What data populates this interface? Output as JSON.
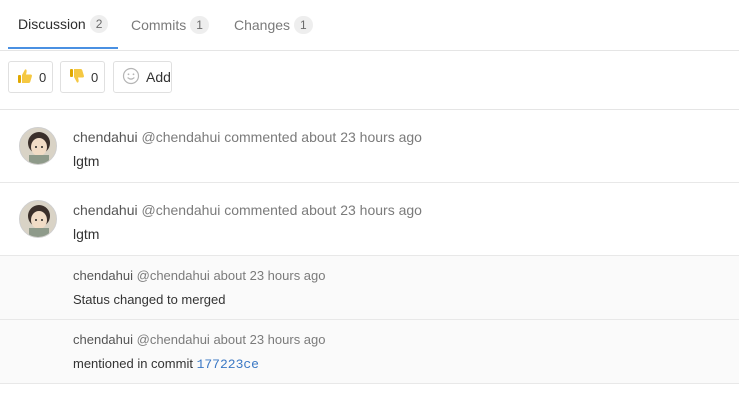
{
  "tabs": [
    {
      "label": "Discussion",
      "count": "2"
    },
    {
      "label": "Commits",
      "count": "1"
    },
    {
      "label": "Changes",
      "count": "1"
    }
  ],
  "awards": {
    "thumbs_up_count": "0",
    "thumbs_down_count": "0",
    "add_label": "Add"
  },
  "notes": [
    {
      "author": "chendahui",
      "handle": "@chendahui",
      "action": "commented",
      "time": "about 23 hours ago",
      "body": "lgtm"
    },
    {
      "author": "chendahui",
      "handle": "@chendahui",
      "action": "commented",
      "time": "about 23 hours ago",
      "body": "lgtm"
    },
    {
      "author": "chendahui",
      "handle": "@chendahui",
      "time": "about 23 hours ago",
      "body": "Status changed to merged"
    },
    {
      "author": "chendahui",
      "handle": "@chendahui",
      "time": "about 23 hours ago",
      "body": "mentioned in commit",
      "commit": "177223ce"
    }
  ],
  "colors": {
    "accent": "#4a90e2",
    "link": "#3b78c4",
    "thumb": "#f5c842"
  }
}
